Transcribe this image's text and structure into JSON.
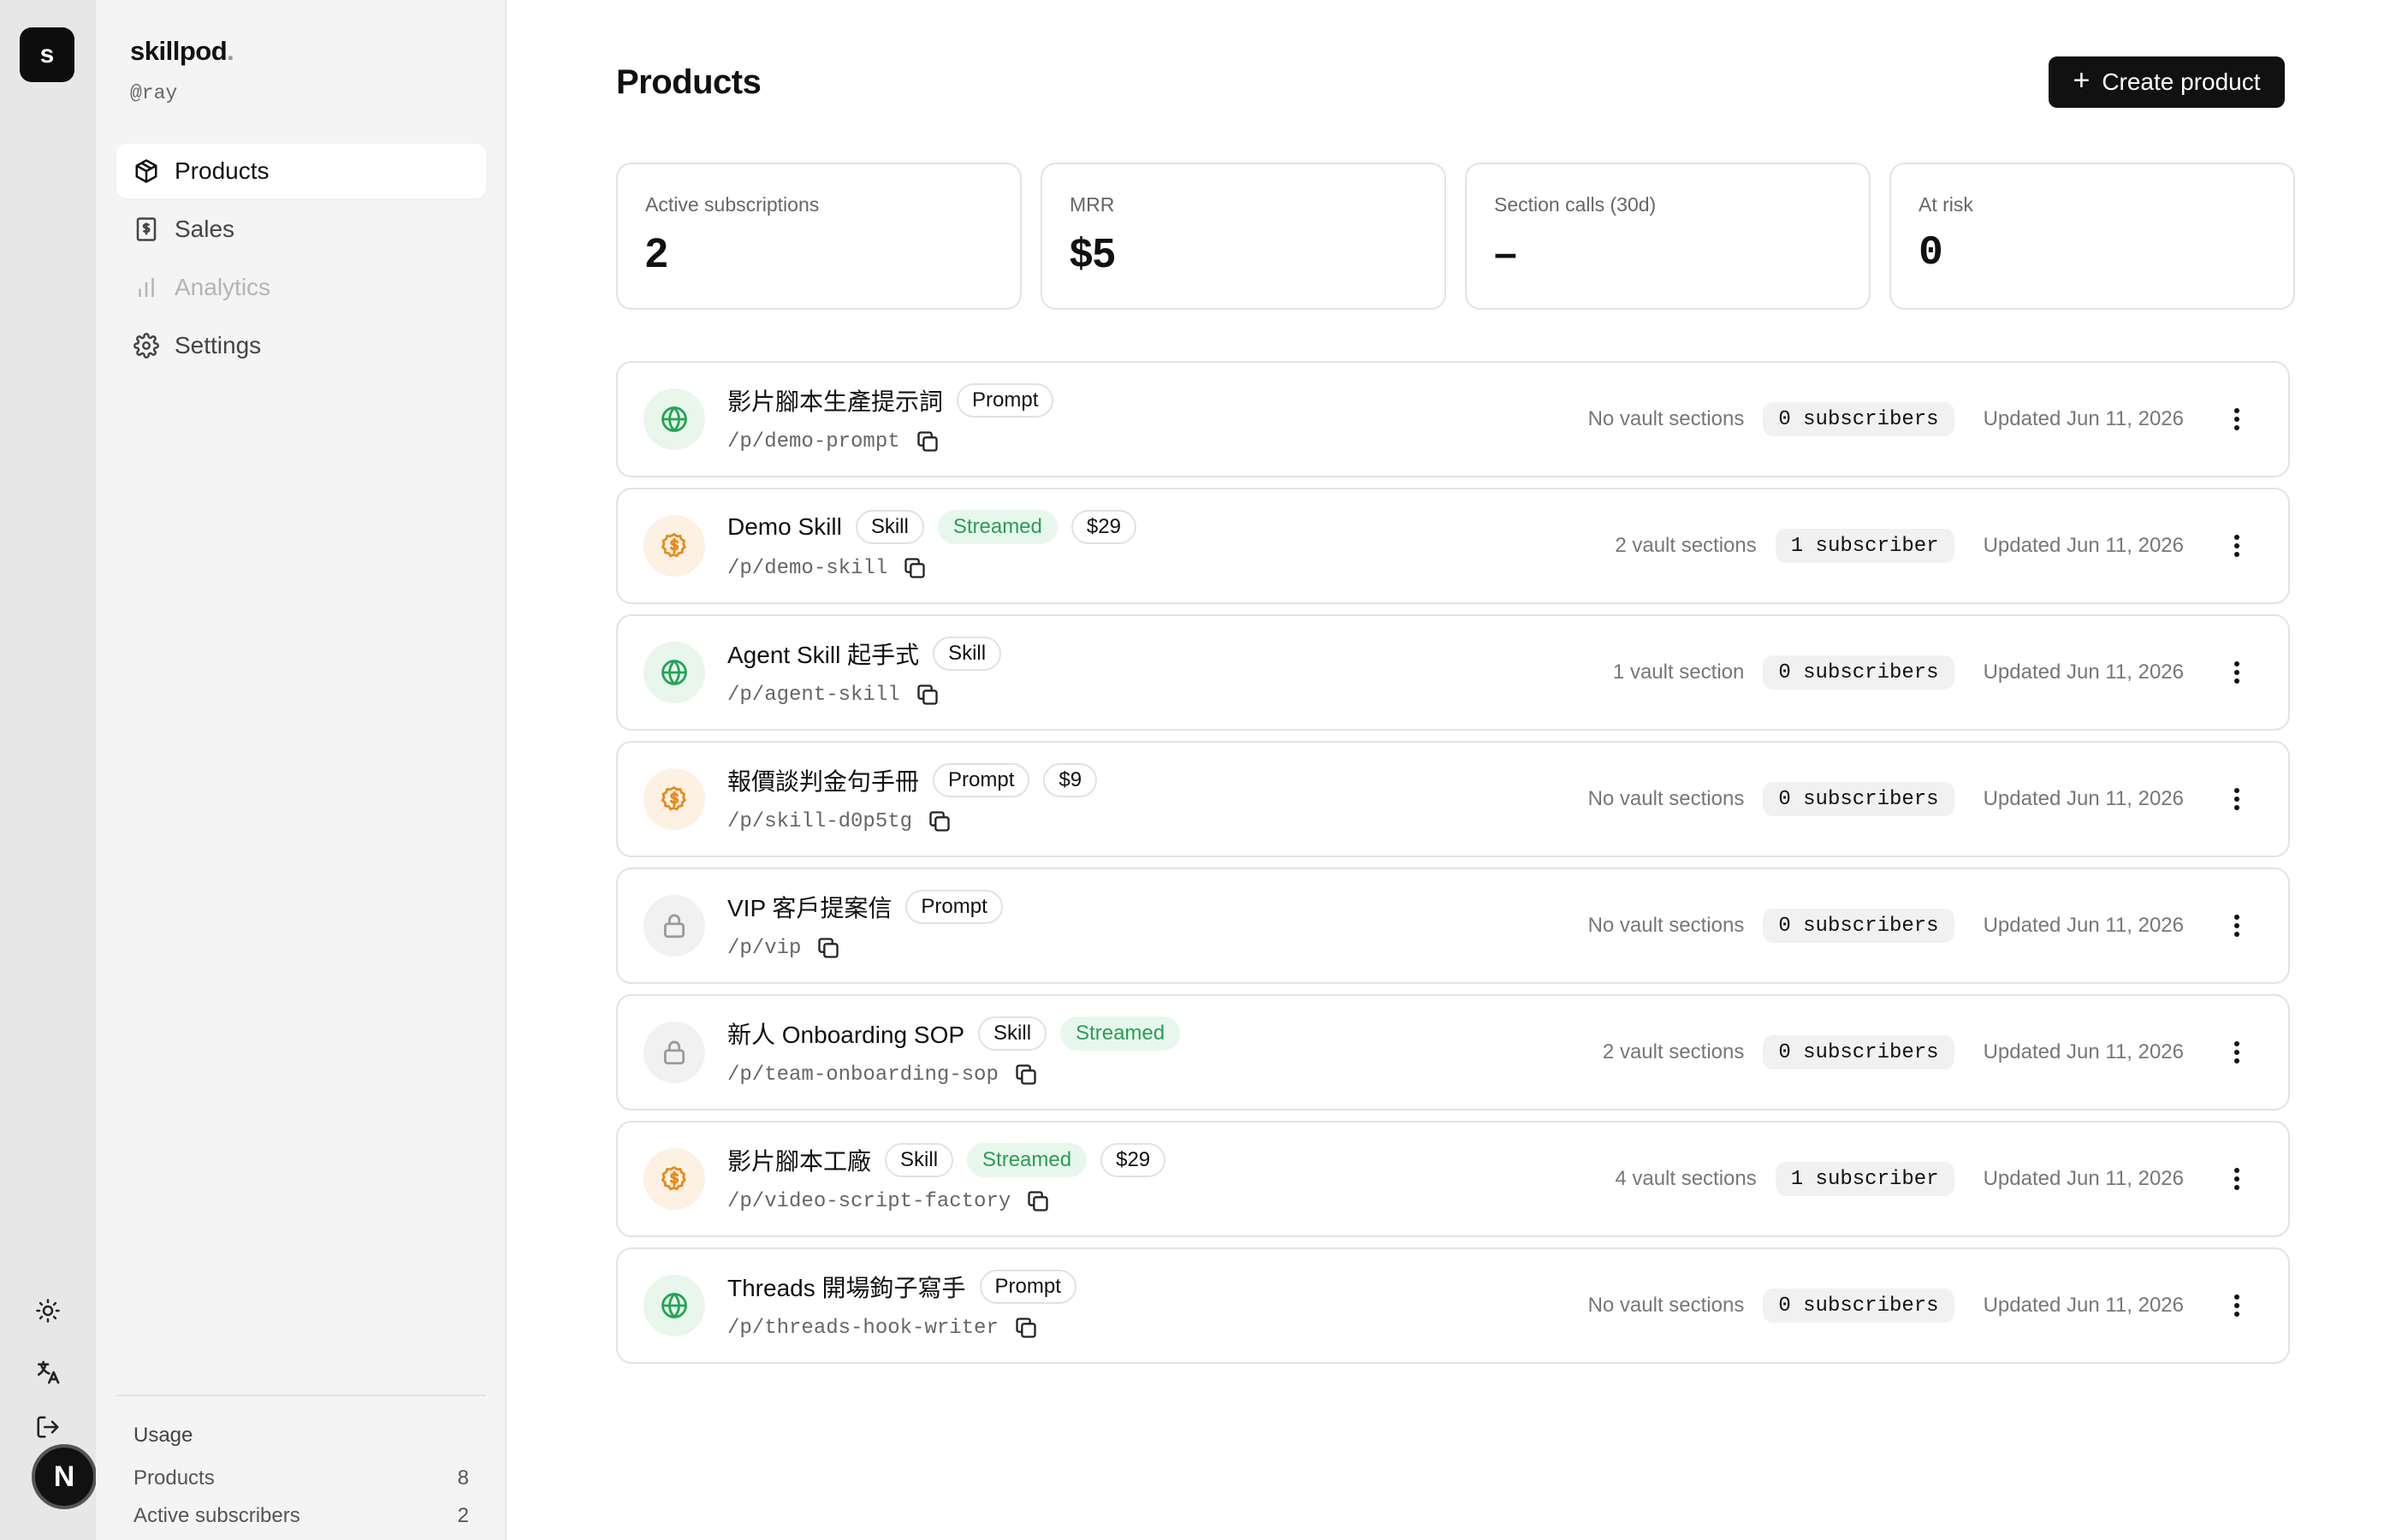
{
  "rail": {
    "logo_letter": "s",
    "avatar_letter": "N"
  },
  "sidebar": {
    "brand": "skillpod",
    "brand_dot": ".",
    "handle": "@ray",
    "nav": [
      {
        "label": "Products",
        "icon": "package-icon",
        "state": "active"
      },
      {
        "label": "Sales",
        "icon": "receipt-icon",
        "state": "normal"
      },
      {
        "label": "Analytics",
        "icon": "bar-chart-icon",
        "state": "disabled"
      },
      {
        "label": "Settings",
        "icon": "gear-icon",
        "state": "normal"
      }
    ],
    "usage": {
      "title": "Usage",
      "rows": [
        {
          "label": "Products",
          "value": "8"
        },
        {
          "label": "Active subscribers",
          "value": "2"
        }
      ]
    }
  },
  "main": {
    "title": "Products",
    "create_label": "Create product",
    "stats": [
      {
        "label": "Active subscriptions",
        "value": "2"
      },
      {
        "label": "MRR",
        "value": "$5"
      },
      {
        "label": "Section calls (30d)",
        "value": "–"
      },
      {
        "label": "At risk",
        "value": "0"
      }
    ],
    "products": [
      {
        "icon": "globe",
        "name": "影片腳本生產提示詞",
        "badges": [
          "Prompt"
        ],
        "streamed": false,
        "price": "",
        "slug": "/p/demo-prompt",
        "vault": "No vault sections",
        "subscribers": "0 subscribers",
        "updated": "Updated Jun 11, 2026"
      },
      {
        "icon": "dollar",
        "name": "Demo Skill",
        "badges": [
          "Skill"
        ],
        "streamed": true,
        "price": "$29",
        "slug": "/p/demo-skill",
        "vault": "2 vault sections",
        "subscribers": "1 subscriber",
        "updated": "Updated Jun 11, 2026"
      },
      {
        "icon": "globe",
        "name": "Agent Skill 起手式",
        "badges": [
          "Skill"
        ],
        "streamed": false,
        "price": "",
        "slug": "/p/agent-skill",
        "vault": "1 vault section",
        "subscribers": "0 subscribers",
        "updated": "Updated Jun 11, 2026"
      },
      {
        "icon": "dollar",
        "name": "報價談判金句手冊",
        "badges": [
          "Prompt"
        ],
        "streamed": false,
        "price": "$9",
        "slug": "/p/skill-d0p5tg",
        "vault": "No vault sections",
        "subscribers": "0 subscribers",
        "updated": "Updated Jun 11, 2026"
      },
      {
        "icon": "lock",
        "name": "VIP 客戶提案信",
        "badges": [
          "Prompt"
        ],
        "streamed": false,
        "price": "",
        "slug": "/p/vip",
        "vault": "No vault sections",
        "subscribers": "0 subscribers",
        "updated": "Updated Jun 11, 2026"
      },
      {
        "icon": "lock",
        "name": "新人 Onboarding SOP",
        "badges": [
          "Skill"
        ],
        "streamed": true,
        "price": "",
        "slug": "/p/team-onboarding-sop",
        "vault": "2 vault sections",
        "subscribers": "0 subscribers",
        "updated": "Updated Jun 11, 2026"
      },
      {
        "icon": "dollar",
        "name": "影片腳本工廠",
        "badges": [
          "Skill"
        ],
        "streamed": true,
        "price": "$29",
        "slug": "/p/video-script-factory",
        "vault": "4 vault sections",
        "subscribers": "1 subscriber",
        "updated": "Updated Jun 11, 2026"
      },
      {
        "icon": "globe",
        "name": "Threads 開場鉤子寫手",
        "badges": [
          "Prompt"
        ],
        "streamed": false,
        "price": "",
        "slug": "/p/threads-hook-writer",
        "vault": "No vault sections",
        "subscribers": "0 subscribers",
        "updated": "Updated Jun 11, 2026"
      }
    ],
    "streamed_label": "Streamed"
  }
}
